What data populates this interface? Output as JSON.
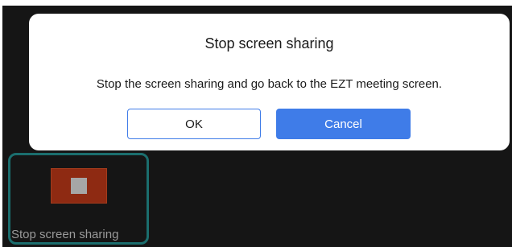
{
  "dialog": {
    "title": "Stop screen sharing",
    "message": "Stop the screen sharing and go back to the EZT meeting screen.",
    "ok_label": "OK",
    "cancel_label": "Cancel"
  },
  "share_control": {
    "label": "Stop screen sharing",
    "icon": "stop-icon"
  },
  "colors": {
    "accent": "#3f7ce8",
    "stop_red": "#8e2a12",
    "tile_border": "#1b6e6e",
    "background": "#151515"
  }
}
